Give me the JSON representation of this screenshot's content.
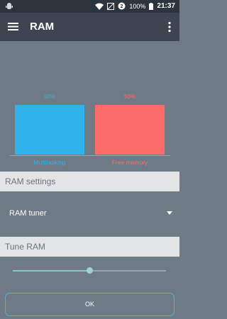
{
  "status_bar": {
    "battery": "100%",
    "time": "21:37"
  },
  "toolbar": {
    "title": "RAM"
  },
  "colors": {
    "multitasking": "#2fb3ea",
    "free_memory": "#fc6d6a"
  },
  "chart_data": {
    "type": "bar",
    "categories": [
      "Multitasking",
      "Free memory"
    ],
    "values": [
      50,
      50
    ],
    "value_labels": [
      "50%",
      "50%"
    ],
    "ylim": [
      0,
      100
    ]
  },
  "ram_settings": {
    "header": "RAM settings",
    "tuner_label": "RAM tuner"
  },
  "tune_ram": {
    "header": "Tune RAM",
    "slider_value": 0.5
  },
  "ok_button": {
    "label": "OK"
  }
}
